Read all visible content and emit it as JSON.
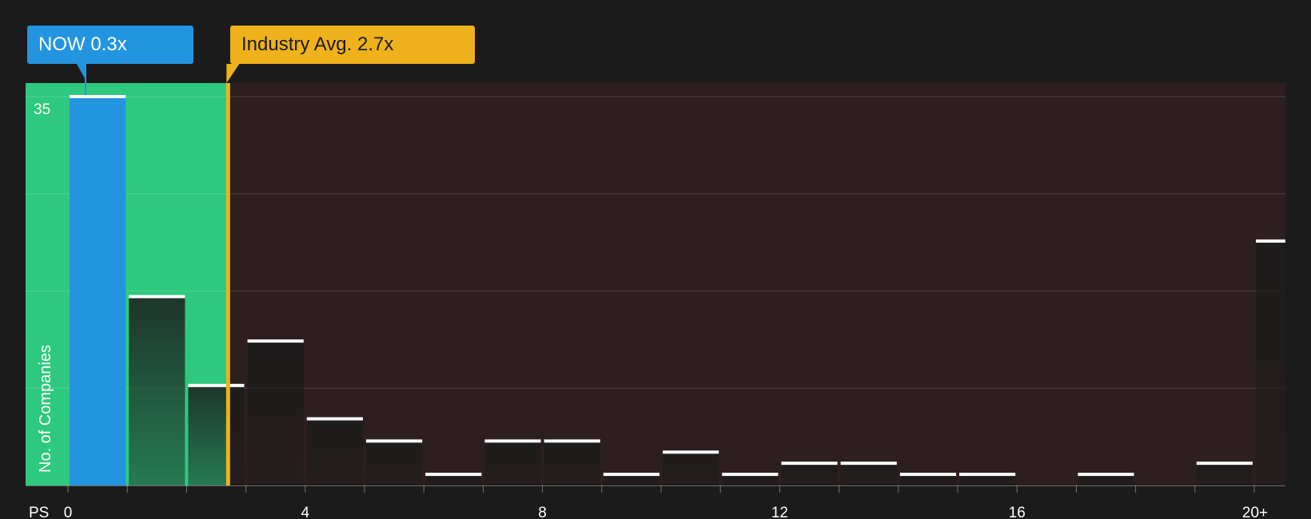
{
  "callouts": {
    "company": {
      "ticker": "NOW",
      "value_text": "0.3x",
      "value": 0.3
    },
    "industry": {
      "label": "Industry Avg.",
      "value_text": "2.7x",
      "value": 2.7
    }
  },
  "colors": {
    "background": "#1b1b1b",
    "undervalued_zone": "#2ec97e",
    "overvalued_zone": "#2d1e1f",
    "company": "#2394e0",
    "industry": "#efb21c",
    "bar_top": "#ffffff"
  },
  "chart_data": {
    "type": "bar",
    "xlabel": "PS",
    "ylabel": "No. of Companies",
    "x_ticks": [
      "0",
      "4",
      "8",
      "12",
      "16",
      "20+"
    ],
    "y_tick_labels": [
      "35"
    ],
    "ylim": [
      0,
      35
    ],
    "grid": true,
    "bins": [
      {
        "from": 0,
        "to": 1,
        "count": 35
      },
      {
        "from": 1,
        "to": 2,
        "count": 17
      },
      {
        "from": 2,
        "to": 3,
        "count": 9
      },
      {
        "from": 3,
        "to": 4,
        "count": 13
      },
      {
        "from": 4,
        "to": 5,
        "count": 6
      },
      {
        "from": 5,
        "to": 6,
        "count": 4
      },
      {
        "from": 6,
        "to": 7,
        "count": 1
      },
      {
        "from": 7,
        "to": 8,
        "count": 4
      },
      {
        "from": 8,
        "to": 9,
        "count": 4
      },
      {
        "from": 9,
        "to": 10,
        "count": 1
      },
      {
        "from": 10,
        "to": 11,
        "count": 3
      },
      {
        "from": 11,
        "to": 12,
        "count": 1
      },
      {
        "from": 12,
        "to": 13,
        "count": 2
      },
      {
        "from": 13,
        "to": 14,
        "count": 2
      },
      {
        "from": 14,
        "to": 15,
        "count": 1
      },
      {
        "from": 15,
        "to": 16,
        "count": 1
      },
      {
        "from": 16,
        "to": 17,
        "count": 0
      },
      {
        "from": 17,
        "to": 18,
        "count": 1
      },
      {
        "from": 18,
        "to": 19,
        "count": 0
      },
      {
        "from": 19,
        "to": 20,
        "count": 2
      },
      {
        "from": 20,
        "to": 21,
        "count": 22
      }
    ],
    "company_value": 0.3,
    "industry_value": 2.7
  }
}
